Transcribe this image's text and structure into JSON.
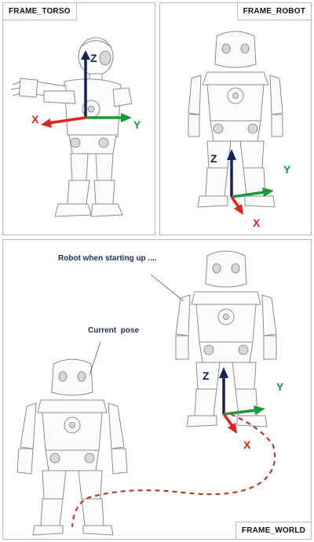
{
  "panels": {
    "torso": {
      "label": "FRAME_TORSO"
    },
    "robot": {
      "label": "FRAME_ROBOT"
    },
    "world": {
      "label": "FRAME_WORLD"
    }
  },
  "axes": {
    "x_label": "X",
    "y_label": "Y",
    "z_label": "Z",
    "x_color": "#e0241b",
    "y_color": "#1a9a3a",
    "z_color": "#13225b"
  },
  "annotations": {
    "startup": "Robot when starting up ....",
    "current": "Current  pose"
  },
  "colors": {
    "path_dashes": "#c0392b",
    "robot_outline": "#8c8c8c"
  }
}
